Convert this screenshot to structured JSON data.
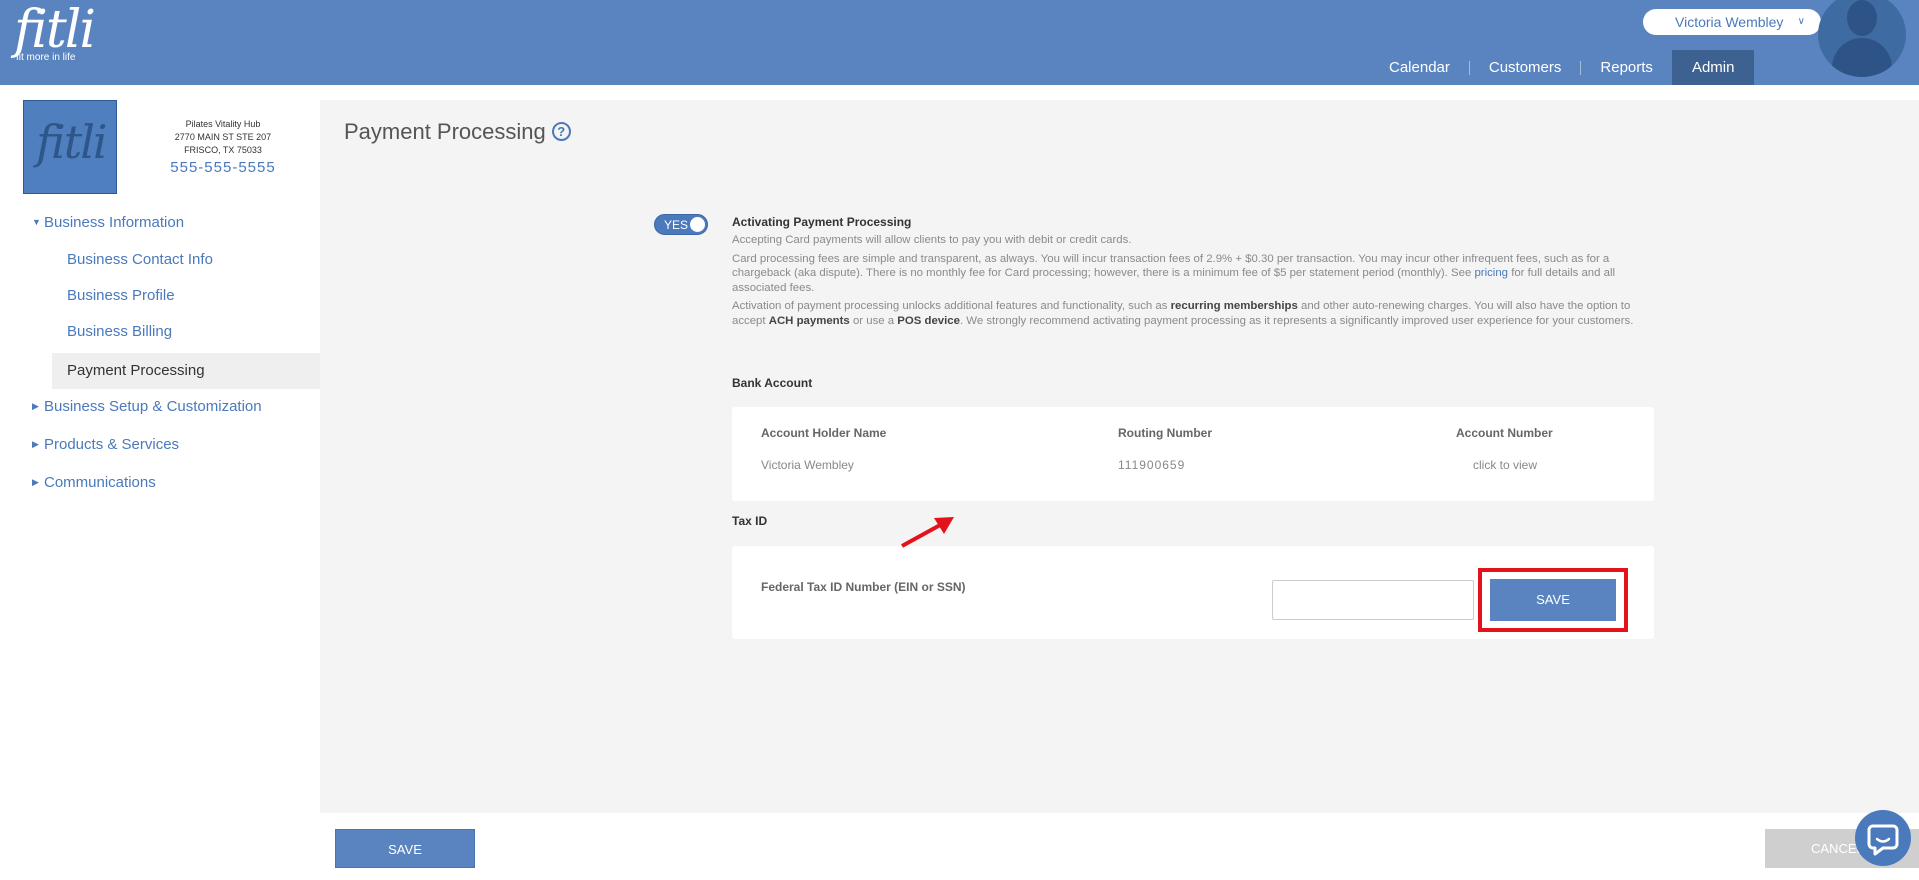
{
  "header": {
    "logo_text": "fitli",
    "logo_tagline": "fit more in life",
    "user_name": "Victoria Wembley",
    "nav": [
      {
        "label": "Calendar"
      },
      {
        "label": "Customers"
      },
      {
        "label": "Reports"
      },
      {
        "label": "Admin"
      }
    ]
  },
  "sidebar": {
    "business": {
      "logo_text": "fitli",
      "name": "Pilates Vitality Hub",
      "address1": "2770 MAIN ST STE 207",
      "address2": "FRISCO, TX 75033",
      "phone": "555-555-5555"
    },
    "groups": [
      {
        "label": "Business Information",
        "expanded": true
      },
      {
        "label": "Business Setup & Customization",
        "expanded": false
      },
      {
        "label": "Products & Services",
        "expanded": false
      },
      {
        "label": "Communications",
        "expanded": false
      }
    ],
    "sub_items": [
      {
        "label": "Business Contact Info"
      },
      {
        "label": "Business Profile"
      },
      {
        "label": "Business Billing"
      },
      {
        "label": "Payment Processing"
      }
    ]
  },
  "main": {
    "title": "Payment Processing",
    "help_icon": "?",
    "toggle_label": "YES",
    "activating_title": "Activating Payment Processing",
    "intro": "Accepting Card payments will allow clients to pay you with debit or credit cards.",
    "fees_text_1": "Card processing fees are simple and transparent, as always. You will incur transaction fees of 2.9% + $0.30 per transaction. You may incur other infrequent fees, such as for a chargeback (aka dispute). There is no monthly fee for Card processing; however, there is a minimum fee of $5 per statement period (monthly). See",
    "fees_link": "pricing",
    "fees_text_2": "for full details and all associated fees.",
    "activation_text_1": "Activation of payment processing unlocks additional features and functionality, such as",
    "activation_bold_1": "recurring memberships",
    "activation_text_2": "and other auto-renewing charges. You will also have the option to accept",
    "activation_bold_2": "ACH payments",
    "activation_text_3": "or use a",
    "activation_bold_3": "POS device",
    "activation_text_4": ". We strongly recommend activating payment processing as it represents a significantly improved user experience for your customers.",
    "bank_account": {
      "heading": "Bank Account",
      "holder_header": "Account Holder Name",
      "routing_header": "Routing Number",
      "account_header": "Account Number",
      "holder_value": "Victoria Wembley",
      "routing_value": "111900659",
      "account_link": "click to view"
    },
    "tax": {
      "heading": "Tax ID",
      "label": "Federal Tax ID Number (EIN or SSN)",
      "input_value": "",
      "save_label": "SAVE"
    }
  },
  "footer": {
    "save_label": "SAVE",
    "cancel_label": "CANCEL"
  },
  "colors": {
    "primary": "#5a84c0",
    "nav_active": "#3d6291",
    "link": "#4a79bc",
    "highlight": "#e3121b",
    "page_bg": "#f4f4f4"
  }
}
